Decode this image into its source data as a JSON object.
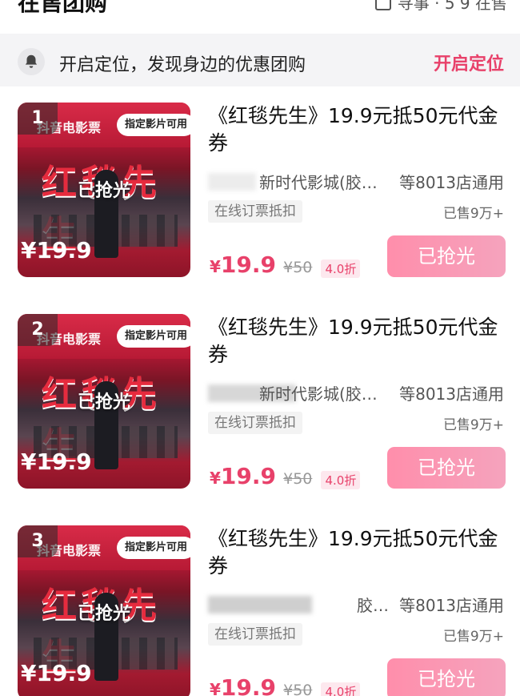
{
  "header": {
    "title": "在售团购",
    "right_text": "寻事 · 5 9 在售"
  },
  "location_bar": {
    "prompt": "开启定位，发现身边的优惠团购",
    "action": "开启定位"
  },
  "items": [
    {
      "rank": "1",
      "poster_brand": "抖音电影票",
      "poster_tag": "指定影片可用",
      "poster_title": "红毯先生",
      "poster_sold": "已抢光",
      "poster_price": "¥19.9",
      "name": "《红毯先生》19.9元抵50元代金券",
      "store": "新时代影城(胶…",
      "store_count": "等8013店通用",
      "tag": "在线订票抵扣",
      "sold": "已售9万+",
      "currency": "¥",
      "price": "19.9",
      "original_price": "¥50",
      "discount": "4.0折",
      "button": "已抢光"
    },
    {
      "rank": "2",
      "poster_brand": "抖音电影票",
      "poster_tag": "指定影片可用",
      "poster_title": "红毯先生",
      "poster_sold": "已抢光",
      "poster_price": "¥19.9",
      "name": "《红毯先生》19.9元抵50元代金券",
      "store": "新时代影城(胶…",
      "store_count": "等8013店通用",
      "tag": "在线订票抵扣",
      "sold": "已售9万+",
      "currency": "¥",
      "price": "19.9",
      "original_price": "¥50",
      "discount": "4.0折",
      "button": "已抢光"
    },
    {
      "rank": "3",
      "poster_brand": "抖音电影票",
      "poster_tag": "指定影片可用",
      "poster_title": "红毯先生",
      "poster_sold": "已抢光",
      "poster_price": "¥19.9",
      "name": "《红毯先生》19.9元抵50元代金券",
      "store": "胶…",
      "store_count": "等8013店通用",
      "tag": "在线订票抵扣",
      "sold": "已售9万+",
      "currency": "¥",
      "price": "19.9",
      "original_price": "¥50",
      "discount": "4.0折",
      "button": "已抢光"
    }
  ]
}
